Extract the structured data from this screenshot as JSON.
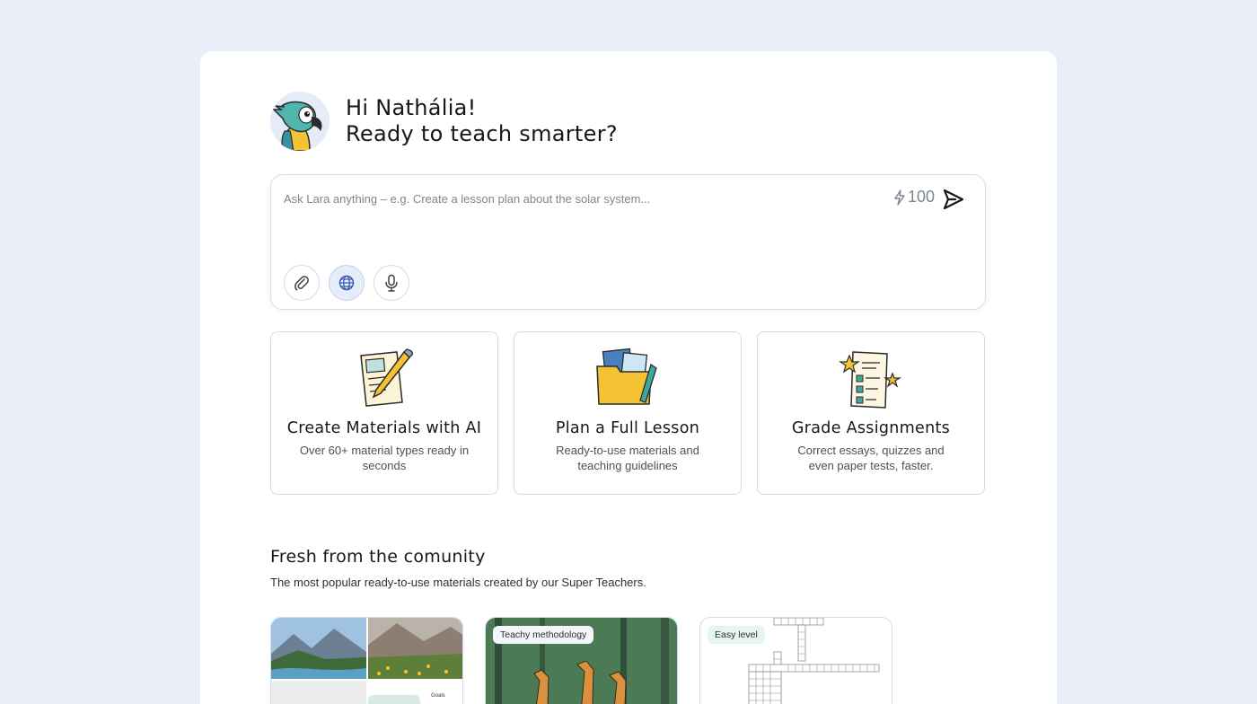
{
  "greeting": {
    "line1": "Hi Nathália!",
    "line2": "Ready to teach smarter?"
  },
  "prompt": {
    "placeholder": "Ask Lara anything – e.g. Create a lesson plan about the solar system...",
    "credits": "100"
  },
  "cards": [
    {
      "title": "Create Materials with AI",
      "desc": "Over 60+ material types ready in seconds"
    },
    {
      "title": "Plan a Full Lesson",
      "desc": "Ready-to-use materials and teaching guidelines"
    },
    {
      "title": "Grade Assignments",
      "desc": "Correct essays, quizzes and even paper tests, faster."
    }
  ],
  "community": {
    "title": "Fresh from the comunity",
    "subtitle": "The most popular ready-to-use materials created by our Super Teachers."
  },
  "thumbnails": [
    {
      "badge": "",
      "label": "Goals"
    },
    {
      "badge": "Teachy methodology"
    },
    {
      "badge": "Easy level"
    }
  ],
  "colors": {
    "background": "#e9eef9",
    "panel": "#ffffff",
    "border": "#d3dcec",
    "accent_yellow": "#f5c233",
    "accent_teal": "#3fa6a0"
  }
}
